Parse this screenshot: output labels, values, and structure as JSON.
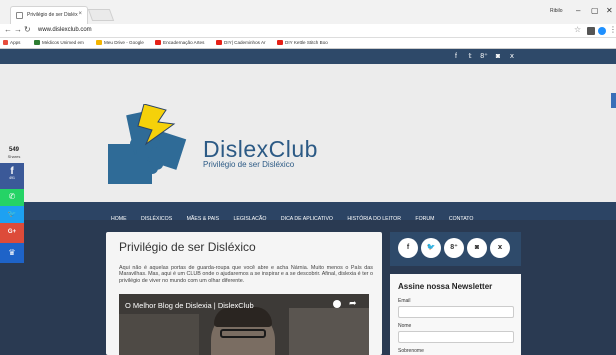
{
  "browser": {
    "tab_title": "Privilégio de ser Disléx",
    "tab_close": "×",
    "profile": "Ribilo",
    "win_min": "–",
    "win_max": "▢",
    "win_close": "✕",
    "url": "www.dislexclub.com",
    "bookmarks": [
      {
        "label": "Apps",
        "color": "#e74c3c"
      },
      {
        "label": "Médicos Unimed em",
        "color": "#2e7d32"
      },
      {
        "label": "Meu Drive - Google",
        "color": "#f4b400"
      },
      {
        "label": "Encadernação Artes",
        "color": "#e62117"
      },
      {
        "label": "DIY| Cademinhos Ar",
        "color": "#e62117"
      },
      {
        "label": "DIY Kettle Stitch Boo",
        "color": "#e62117"
      }
    ]
  },
  "site": {
    "social_top": [
      "f",
      "𝕥",
      "8⁺",
      "◙",
      "ⅹ"
    ],
    "logo": {
      "title": "DislexClub",
      "subtitle": "Privilégio de ser Disléxico"
    },
    "nav": [
      "Home",
      "Disléxicos",
      "Mães & Pais",
      "Legislação",
      "Dica de Aplicativo",
      "História do Leitor",
      "Forum",
      "Contato"
    ],
    "share": {
      "count": "549",
      "label": "Shares",
      "buttons": [
        {
          "name": "facebook",
          "glyph": "f",
          "count": "491",
          "color": "#3b5998"
        },
        {
          "name": "whatsapp",
          "glyph": "✆",
          "count": "",
          "color": "#25d366"
        },
        {
          "name": "twitter",
          "glyph": "🐦",
          "count": "",
          "color": "#1da1f2"
        },
        {
          "name": "googleplus",
          "glyph": "G+",
          "count": "",
          "color": "#dd4b39"
        },
        {
          "name": "crown",
          "glyph": "♛",
          "count": "",
          "color": "#1e63c8"
        }
      ]
    },
    "article": {
      "title": "Privilégio de ser Disléxico",
      "intro": "Aqui não é aquelas portas de guarda-roupa que você abre e acha Nárnia. Muito menos o País das Maravilhas. Mas, aqui é um CLUB onde o ajudaremos a se inspirar e a se descobrir. Afinal, dislexia é ter o privilégio de viver no mundo com um olhar diferente.",
      "video_title": "O Melhor Blog de Dislexia | DislexClub",
      "video_share": "➦"
    },
    "sidebar": {
      "circles": [
        "f",
        "🐦",
        "8⁺",
        "◙",
        "ⅹ"
      ],
      "newsletter": {
        "title": "Assine nossa Newsletter",
        "fields": [
          "Email",
          "Nome",
          "Sobrenome"
        ]
      }
    }
  }
}
